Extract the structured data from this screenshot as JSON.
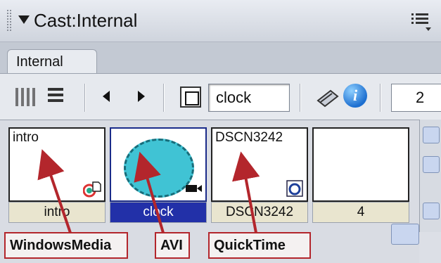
{
  "window": {
    "title": "Cast:Internal"
  },
  "tabs": [
    {
      "label": "Internal"
    }
  ],
  "toolbar": {
    "member_name": "clock",
    "member_number": "2"
  },
  "cast": [
    {
      "thumb_text": "intro",
      "caption": "intro",
      "selected": false,
      "type_icon": "windows-media-icon"
    },
    {
      "thumb_text": "",
      "caption": "clock",
      "selected": true,
      "type_icon": "avi-icon"
    },
    {
      "thumb_text": "DSCN3242",
      "caption": "DSCN3242",
      "selected": false,
      "type_icon": "quicktime-icon"
    },
    {
      "thumb_text": "",
      "caption": "4",
      "selected": false,
      "type_icon": ""
    }
  ],
  "annotations": [
    {
      "label": "WindowsMedia"
    },
    {
      "label": "AVI"
    },
    {
      "label": "QuickTime"
    }
  ],
  "colors": {
    "selection": "#2230a8",
    "annotation": "#b3262c",
    "arrow": "#b3262c"
  }
}
